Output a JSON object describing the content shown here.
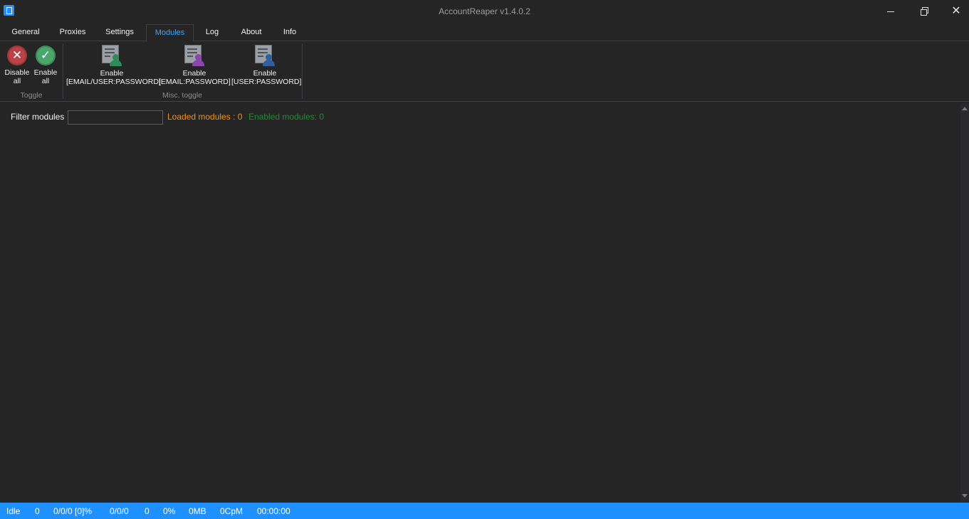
{
  "window": {
    "title": "AccountReaper v1.4.0.2",
    "minimize_icon": "minimize-icon",
    "maximize_icon": "restore-icon",
    "close_icon": "close-icon",
    "close_glyph": "✕"
  },
  "tabs": [
    {
      "label": "General",
      "active": false
    },
    {
      "label": "Proxies",
      "active": false
    },
    {
      "label": "Settings",
      "active": false
    },
    {
      "label": "Modules",
      "active": true
    },
    {
      "label": "Log",
      "active": false
    },
    {
      "label": "About",
      "active": false
    },
    {
      "label": "Info",
      "active": false
    }
  ],
  "ribbon": {
    "toggle_group": {
      "label": "Toggle",
      "disable_all": {
        "line1": "Disable",
        "line2": "all",
        "icon": "x-circle-icon",
        "glyph": "✕"
      },
      "enable_all": {
        "line1": "Enable",
        "line2": "all",
        "icon": "check-circle-icon",
        "glyph": "✓"
      }
    },
    "misc_group": {
      "label": "Misc. toggle",
      "buttons": [
        {
          "line1": "Enable",
          "line2": "[EMAIL/USER:PASSWORD]",
          "icon": "user-list-icon",
          "person_color": "#2e8b57"
        },
        {
          "line1": "Enable",
          "line2": "[EMAIL:PASSWORD]",
          "icon": "user-list-icon",
          "person_color": "#8e44ad"
        },
        {
          "line1": "Enable",
          "line2": "[USER:PASSWORD]",
          "icon": "user-list-icon",
          "person_color": "#2f5f9e"
        }
      ]
    }
  },
  "filter": {
    "label": "Filter modules",
    "value": "",
    "placeholder": ""
  },
  "counters": {
    "loaded": "Loaded modules : 0",
    "enabled": "Enabled modules: 0",
    "loaded_color": "#f5901e",
    "enabled_color": "#1e8e2e"
  },
  "status": {
    "state": "Idle",
    "v1": "0",
    "v2": "0/0/0 [0]%",
    "v3": "0/0/0",
    "v4": "0",
    "v5": "0%",
    "v6": "0MB",
    "v7": "0CpM",
    "v8": "00:00:00",
    "bar_color": "#1e90ff"
  }
}
